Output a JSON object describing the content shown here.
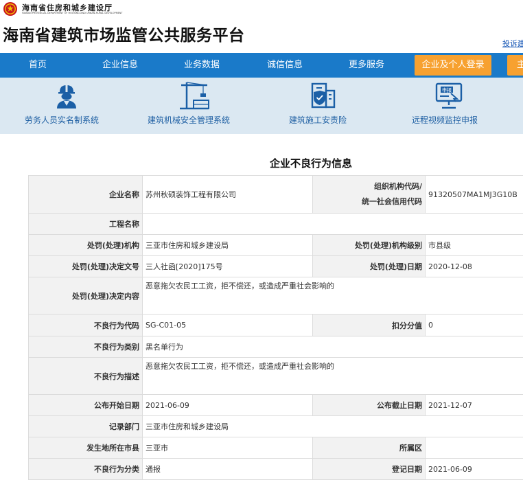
{
  "header": {
    "dept_cn": "海南省住房和城乡建设厅",
    "dept_en": "HAINAN PROVINCIAL DEPARTMENT OF HOUSING AND URBAN-RURAL DEVELOPMENT",
    "site_title": "海南省建筑市场监管公共服务平台",
    "complaint_link": "投诉建"
  },
  "nav": {
    "items": [
      "首页",
      "企业信息",
      "业务数据",
      "诚信信息",
      "更多服务"
    ],
    "login": "企业及个人登录",
    "extra": "主"
  },
  "systems": [
    {
      "label": "劳务人员实名制系统",
      "icon": "worker-icon"
    },
    {
      "label": "建筑机械安全管理系统",
      "icon": "tower-crane-icon"
    },
    {
      "label": "建筑施工安责险",
      "icon": "building-shield-icon"
    },
    {
      "label": "远程视频监控申报",
      "icon": "monitor-report-icon",
      "icon_text": "申报"
    }
  ],
  "page_title": "企业不良行为信息",
  "record": {
    "company_name_label": "企业名称",
    "company_name": "苏州秋硕装饰工程有限公司",
    "org_code_label_1": "组织机构代码/",
    "org_code_label_2": "统一社会信用代码",
    "org_code": "91320507MA1MJ3G10B",
    "project_label": "工程名称",
    "project": "",
    "authority_label": "处罚(处理)机构",
    "authority": "三亚市住房和城乡建设局",
    "authority_level_label": "处罚(处理)机构级别",
    "authority_level": "市县级",
    "decision_no_label": "处罚(处理)决定文号",
    "decision_no": "三人社函[2020]175号",
    "decision_date_label": "处罚(处理)日期",
    "decision_date": "2020-12-08",
    "decision_content_label": "处罚(处理)决定内容",
    "decision_content": "恶意拖欠农民工工资，拒不偿还，或造成严重社会影响的",
    "behavior_code_label": "不良行为代码",
    "behavior_code": "SG-C01-05",
    "deduct_label": "扣分分值",
    "deduct": "0",
    "behavior_type_label": "不良行为类别",
    "behavior_type": "黑名单行为",
    "behavior_desc_label": "不良行为描述",
    "behavior_desc": "恶意拖欠农民工工资，拒不偿还，或造成严重社会影响的",
    "publish_start_label": "公布开始日期",
    "publish_start": "2021-06-09",
    "publish_end_label": "公布截止日期",
    "publish_end": "2021-12-07",
    "record_dept_label": "记录部门",
    "record_dept": "三亚市住房和城乡建设局",
    "city_label": "发生地所在市县",
    "city": "三亚市",
    "district_label": "所属区",
    "district": "",
    "category_label": "不良行为分类",
    "category": "通报",
    "record_date_label": "登记日期",
    "record_date": "2021-06-09"
  },
  "colors": {
    "nav_bg": "#1a7ac9",
    "login_bg": "#f7a130",
    "system_bar_bg": "#dbe8f2",
    "system_label": "#1e5fa3",
    "label_cell_bg": "#f2f2f2"
  }
}
